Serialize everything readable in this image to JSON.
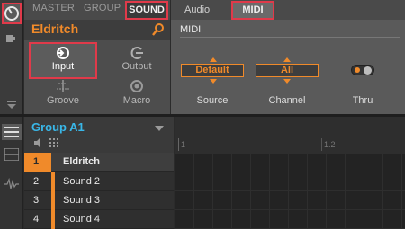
{
  "browser": {
    "tabs": [
      "MASTER",
      "GROUP",
      "SOUND"
    ],
    "selected_tab": "SOUND",
    "sound_name": "Eldritch",
    "modules": [
      {
        "label": "Input",
        "icon": "input-icon",
        "selected": true
      },
      {
        "label": "Output",
        "icon": "output-icon",
        "selected": false
      },
      {
        "label": "Groove",
        "icon": "groove-icon",
        "selected": false
      },
      {
        "label": "Macro",
        "icon": "macro-icon",
        "selected": false
      }
    ]
  },
  "midi_panel": {
    "tabs": [
      "Audio",
      "MIDI"
    ],
    "selected_tab": "MIDI",
    "section_title": "MIDI",
    "params": [
      {
        "value": "Default",
        "label": "Source"
      },
      {
        "value": "All",
        "label": "Channel"
      },
      {
        "value": "",
        "label": "Thru"
      }
    ]
  },
  "group": {
    "name": "Group A1",
    "sounds": [
      {
        "num": "1",
        "name": "Eldritch",
        "selected": true
      },
      {
        "num": "2",
        "name": "Sound 2",
        "selected": false
      },
      {
        "num": "3",
        "name": "Sound 3",
        "selected": false
      },
      {
        "num": "4",
        "name": "Sound 4",
        "selected": false
      }
    ]
  },
  "arranger": {
    "ticks": [
      "1",
      "1.2"
    ]
  },
  "colors": {
    "accent_orange": "#f08a2a",
    "highlight_red": "#e03a4a",
    "group_blue": "#39b7e8"
  }
}
